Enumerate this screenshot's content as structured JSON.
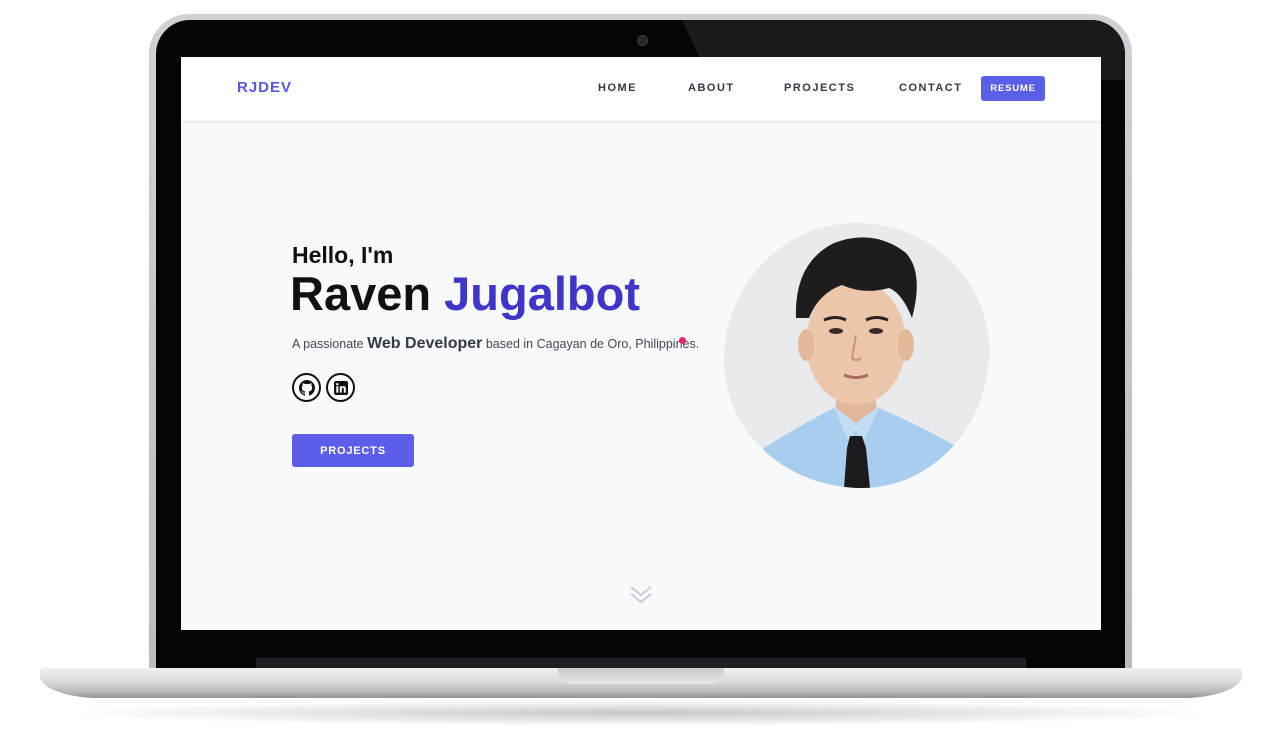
{
  "navbar": {
    "logo": "RJDEV",
    "links": [
      {
        "label": "HOME"
      },
      {
        "label": "ABOUT"
      },
      {
        "label": "PROJECTS"
      },
      {
        "label": "CONTACT"
      }
    ],
    "resume_label": "RESUME"
  },
  "hero": {
    "greeting": "Hello, I'm",
    "first_name": "Raven",
    "last_name": "Jugalbot",
    "tagline_prefix": "A passionate",
    "tagline_role": "Web Developer",
    "tagline_suffix": "based in Cagayan de Oro, Philippines.",
    "social_icons": [
      "github-icon",
      "linkedin-icon"
    ],
    "projects_button": "PROJECTS",
    "scroll_icon": "double-chevron-down-icon"
  },
  "colors": {
    "accent": "#5b5fe8",
    "name_highlight": "#3f35c9",
    "dot": "#e6246f"
  }
}
